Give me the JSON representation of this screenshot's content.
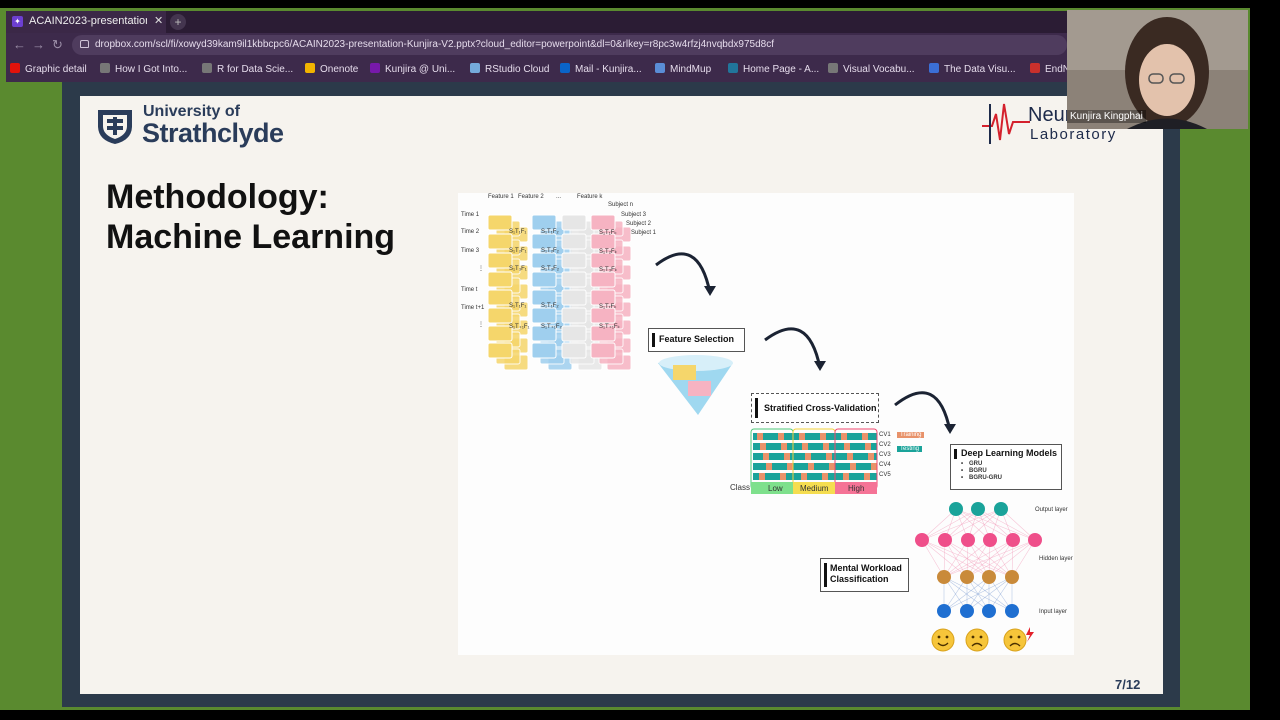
{
  "browser": {
    "tab_title": "ACAIN2023-presentation",
    "tab_favicon": "dropbox-icon",
    "url": "dropbox.com/scl/fi/xowyd39kam9il1kbbcpc6/ACAIN2023-presentation-Kunjira-V2.pptx?cloud_editor=powerpoint&dl=0&rlkey=r8pc3w4rfzj4nvqbdx975d8cf",
    "bookmarks": [
      {
        "label": "Graphic detail",
        "icon": "economist-icon",
        "color": "#e3120b"
      },
      {
        "label": "How I Got Into...",
        "icon": "globe-icon",
        "color": "#777777"
      },
      {
        "label": "R for Data Scie...",
        "icon": "globe-icon",
        "color": "#777777"
      },
      {
        "label": "Onenote",
        "icon": "onenote-icon",
        "color": "#f2b400"
      },
      {
        "label": "Kunjira @ Uni...",
        "icon": "onenote-icon",
        "color": "#7719aa"
      },
      {
        "label": "RStudio Cloud",
        "icon": "rstudio-icon",
        "color": "#75aadb"
      },
      {
        "label": "Mail - Kunjira...",
        "icon": "outlook-icon",
        "color": "#0a64c8"
      },
      {
        "label": "MindMup",
        "icon": "mindmup-icon",
        "color": "#5a8dd6"
      },
      {
        "label": "Home Page - A...",
        "icon": "wordpress-icon",
        "color": "#21759b"
      },
      {
        "label": "Visual Vocabu...",
        "icon": "globe-icon",
        "color": "#777777"
      },
      {
        "label": "The Data Visu...",
        "icon": "chart-icon",
        "color": "#3b6fd6"
      },
      {
        "label": "EndN",
        "icon": "endnote-icon",
        "color": "#c9302c"
      }
    ]
  },
  "slide": {
    "university_small": "University of",
    "university_big": "Strathclyde",
    "title_line1": "Methodology:",
    "title_line2": "Machine Learning",
    "lab_top": "Neur",
    "lab_bottom": "Laboratory",
    "page": "7/12"
  },
  "diagram": {
    "feature_headers": [
      "Feature 1",
      "Feature 2",
      "...",
      "Feature k"
    ],
    "subjects": [
      "Subject n",
      "Subject 3",
      "Subject 2",
      "Subject 1"
    ],
    "time_labels": [
      "Time 1",
      "Time 2",
      "Time 3",
      "⋮",
      "Time t",
      "Time t+1",
      "⋮"
    ],
    "cells_yellow": [
      "S₁T₁F₁",
      "S₁T₂F₁",
      "S₁T₃F₁",
      "S₁T₁F₁",
      "S₁T₊₁F₁"
    ],
    "cells_blue": [
      "S₁T₁F₂",
      "S₁T₂F₂",
      "S₁T₃F₂",
      "S₁T₁F₂",
      "S₁T₊₁F₂"
    ],
    "cells_pink": [
      "S₁T₁Fₖ",
      "S₁T₂Fₖ",
      "S₁T₃Fₖ",
      "S₁TₜFₖ",
      "S₁T₊₁Fₖ"
    ],
    "feature_selection": "Feature Selection",
    "stratified": "Stratified Cross-Validation",
    "cv_labels": [
      "CV1",
      "CV2",
      "CV3",
      "CV4",
      "CV5"
    ],
    "legend_training": "Training",
    "legend_testing": "Testing",
    "class_label": "Class",
    "classes": [
      "Low",
      "Medium",
      "High"
    ],
    "dl_title": "Deep Learning Models",
    "dl_items": [
      "GRU",
      "BGRU",
      "BGRU-GRU"
    ],
    "output_layer": "Output layer",
    "hidden_layer": "Hidden layer",
    "input_layer": "Input layer",
    "mwc_line1": "Mental Workload",
    "mwc_line2": "Classification"
  },
  "webcam": {
    "name": "Kunjira Kingphai"
  }
}
